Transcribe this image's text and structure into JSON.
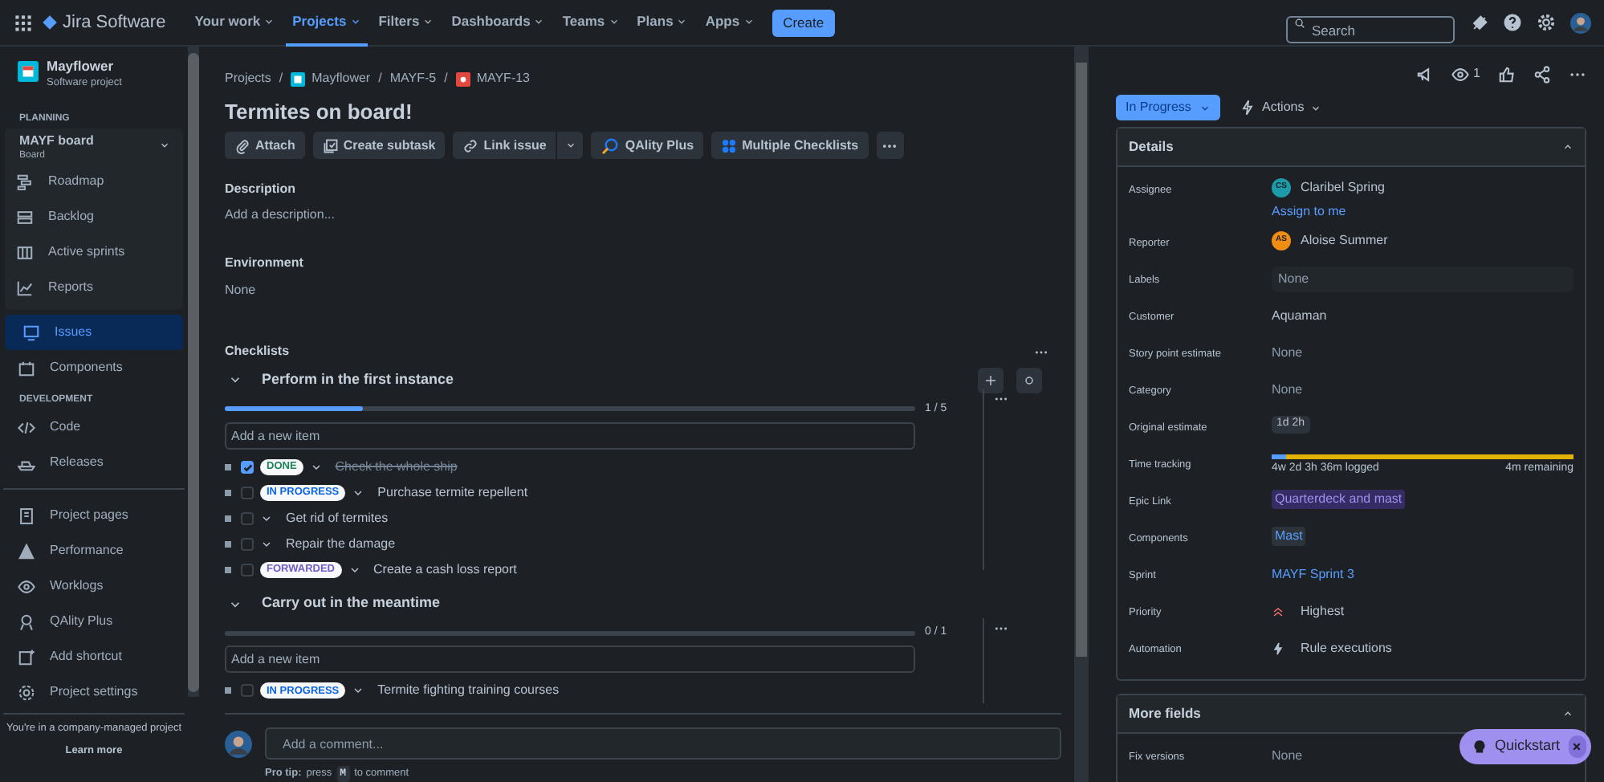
{
  "topbar": {
    "product": "Jira Software",
    "nav": [
      {
        "label": "Your work",
        "selected": false
      },
      {
        "label": "Projects",
        "selected": true
      },
      {
        "label": "Filters",
        "selected": false
      },
      {
        "label": "Dashboards",
        "selected": false
      },
      {
        "label": "Teams",
        "selected": false
      },
      {
        "label": "Plans",
        "selected": false
      },
      {
        "label": "Apps",
        "selected": false
      }
    ],
    "create": "Create",
    "search": {
      "placeholder": "Search"
    }
  },
  "sidebar": {
    "project": {
      "name": "Mayflower",
      "type": "Software project"
    },
    "sections": [
      {
        "heading": "PLANNING",
        "board": {
          "name": "MAYF board",
          "subtitle": "Board",
          "items": [
            {
              "label": "Roadmap",
              "kind": "roadmap"
            },
            {
              "label": "Backlog",
              "kind": "backlog"
            },
            {
              "label": "Active sprints",
              "kind": "sprints"
            },
            {
              "label": "Reports",
              "kind": "reports"
            }
          ]
        },
        "items": [
          {
            "label": "Issues",
            "kind": "issues",
            "selected": true
          },
          {
            "label": "Components",
            "kind": "components",
            "selected": false
          }
        ]
      },
      {
        "heading": "DEVELOPMENT",
        "items": [
          {
            "label": "Code",
            "kind": "code",
            "selected": false
          },
          {
            "label": "Releases",
            "kind": "releases",
            "selected": false
          }
        ]
      },
      {
        "items": [
          {
            "label": "Project pages",
            "kind": "pages",
            "selected": false
          },
          {
            "label": "Performance",
            "kind": "performance",
            "selected": false
          },
          {
            "label": "Worklogs",
            "kind": "worklogs",
            "selected": false
          },
          {
            "label": "QAlity Plus",
            "kind": "qality",
            "selected": false
          },
          {
            "label": "Add shortcut",
            "kind": "shortcut",
            "selected": false
          },
          {
            "label": "Project settings",
            "kind": "settings",
            "selected": false
          }
        ]
      }
    ],
    "footer": {
      "text": "You're in a company-managed project",
      "link": "Learn more"
    }
  },
  "issue": {
    "breadcrumbs": [
      {
        "label": "Projects",
        "kind": "text"
      },
      {
        "label": "Mayflower",
        "kind": "project",
        "separator": "/"
      },
      {
        "label": "MAYF-5",
        "kind": "text",
        "separator": "/"
      },
      {
        "label": "MAYF-13",
        "kind": "bug",
        "separator": "/"
      }
    ],
    "title": "Termites on board!",
    "actions": [
      {
        "label": "Attach",
        "kind": "attach"
      },
      {
        "label": "Create subtask",
        "kind": "subtask"
      },
      {
        "label": "Link issue",
        "kind": "link"
      },
      {
        "label": "QAlity Plus",
        "kind": "qality"
      },
      {
        "label": "Multiple Checklists",
        "kind": "checklists"
      }
    ],
    "description": {
      "heading": "Description",
      "placeholder": "Add a description..."
    },
    "environment": {
      "heading": "Environment",
      "value": "None"
    },
    "checklists": {
      "heading": "Checklists",
      "lists": [
        {
          "title": "Perform in the first instance",
          "level": 0.2,
          "count": "1 / 5",
          "placeholder": "Add a new item",
          "items": [
            {
              "checked": true,
              "status": {
                "label": "DONE",
                "color": "#1f845a"
              },
              "text": "Check the whole ship"
            },
            {
              "checked": false,
              "status": {
                "label": "IN PROGRESS",
                "color": "#0c66e4"
              },
              "text": "Purchase termite repellent"
            },
            {
              "checked": false,
              "text": "Get rid of termites"
            },
            {
              "checked": false,
              "text": "Repair the damage"
            },
            {
              "checked": false,
              "status": {
                "label": "FORWARDED",
                "color": "#6e5dc6"
              },
              "text": "Create a cash loss report"
            }
          ]
        },
        {
          "title": "Carry out in the meantime",
          "level": 0,
          "count": "0 / 1",
          "placeholder": "Add a new item",
          "items": [
            {
              "checked": false,
              "status": {
                "label": "IN PROGRESS",
                "color": "#0c66e4"
              },
              "text": "Termite fighting training courses"
            }
          ]
        }
      ]
    },
    "comment": {
      "placeholder": "Add a comment...",
      "tip_label": "Pro tip:",
      "tip_before": "press",
      "key": "M",
      "tip_after": "to comment"
    }
  },
  "panel": {
    "watchers": "1",
    "status": "In Progress",
    "actions": "Actions",
    "details": {
      "title": "Details",
      "fields": [
        {
          "label": "Assignee",
          "kind": "user",
          "initials": "CS",
          "color": "#1d9aaa",
          "value": "Claribel Spring",
          "link": "Assign to me"
        },
        {
          "label": "Reporter",
          "kind": "user",
          "initials": "AS",
          "color": "#f18d13",
          "value": "Aloise Summer"
        },
        {
          "label": "Labels",
          "kind": "empty",
          "value": "None"
        },
        {
          "label": "Customer",
          "kind": "text",
          "value": "Aquaman"
        },
        {
          "label": "Story point estimate",
          "kind": "none",
          "value": "None"
        },
        {
          "label": "Category",
          "kind": "none",
          "value": "None"
        },
        {
          "label": "Original estimate",
          "kind": "chip",
          "value": "1d 2h"
        },
        {
          "label": "Time tracking",
          "kind": "time",
          "level": 0.05,
          "logged": "4w 2d 3h 36m logged",
          "remaining": "4m remaining"
        },
        {
          "label": "Epic Link",
          "kind": "epic",
          "value": "Quarterdeck and mast"
        },
        {
          "label": "Components",
          "kind": "component",
          "value": "Mast"
        },
        {
          "label": "Sprint",
          "kind": "link",
          "value": "MAYF Sprint 3"
        },
        {
          "label": "Priority",
          "kind": "priority",
          "value": "Highest"
        },
        {
          "label": "Automation",
          "kind": "automation",
          "value": "Rule executions"
        }
      ]
    },
    "more_fields": {
      "title": "More fields",
      "fields": [
        {
          "label": "Fix versions",
          "kind": "none",
          "value": "None"
        }
      ]
    },
    "quickstart": "Quickstart"
  }
}
